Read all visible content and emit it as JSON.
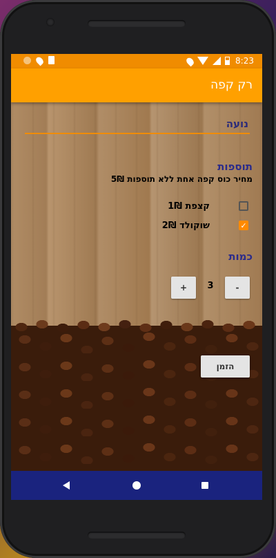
{
  "status_bar": {
    "time": "8:23",
    "left_icons": [
      "notification-circle-icon",
      "location-pin-icon",
      "sd-card-icon"
    ],
    "right_icons": [
      "location-pin-icon",
      "wifi-icon",
      "signal-icon",
      "battery-charging-icon"
    ]
  },
  "app_bar": {
    "title": "רק קפה"
  },
  "form": {
    "name_value": "נועה",
    "toppings_heading": "תוספות",
    "price_text": "מחיר כוס קפה אחת ללא תוספות 5₪",
    "toppings": [
      {
        "label": "קצפת 1₪",
        "checked": false
      },
      {
        "label": "שוקולד 2₪",
        "checked": true
      }
    ],
    "quantity_heading": "כמות",
    "quantity": {
      "value": "3",
      "decrement_label": "-",
      "increment_label": "+"
    },
    "order_button_label": "הזמן"
  },
  "nav_bar": {
    "icons": [
      "back-icon",
      "home-icon",
      "recent-apps-icon"
    ]
  },
  "colors": {
    "app_bar": "#ffa000",
    "status_bar": "#f08c00",
    "accent": "#ff8a00",
    "heading_text": "#2b2b8a",
    "nav_bar": "#1a237e"
  }
}
